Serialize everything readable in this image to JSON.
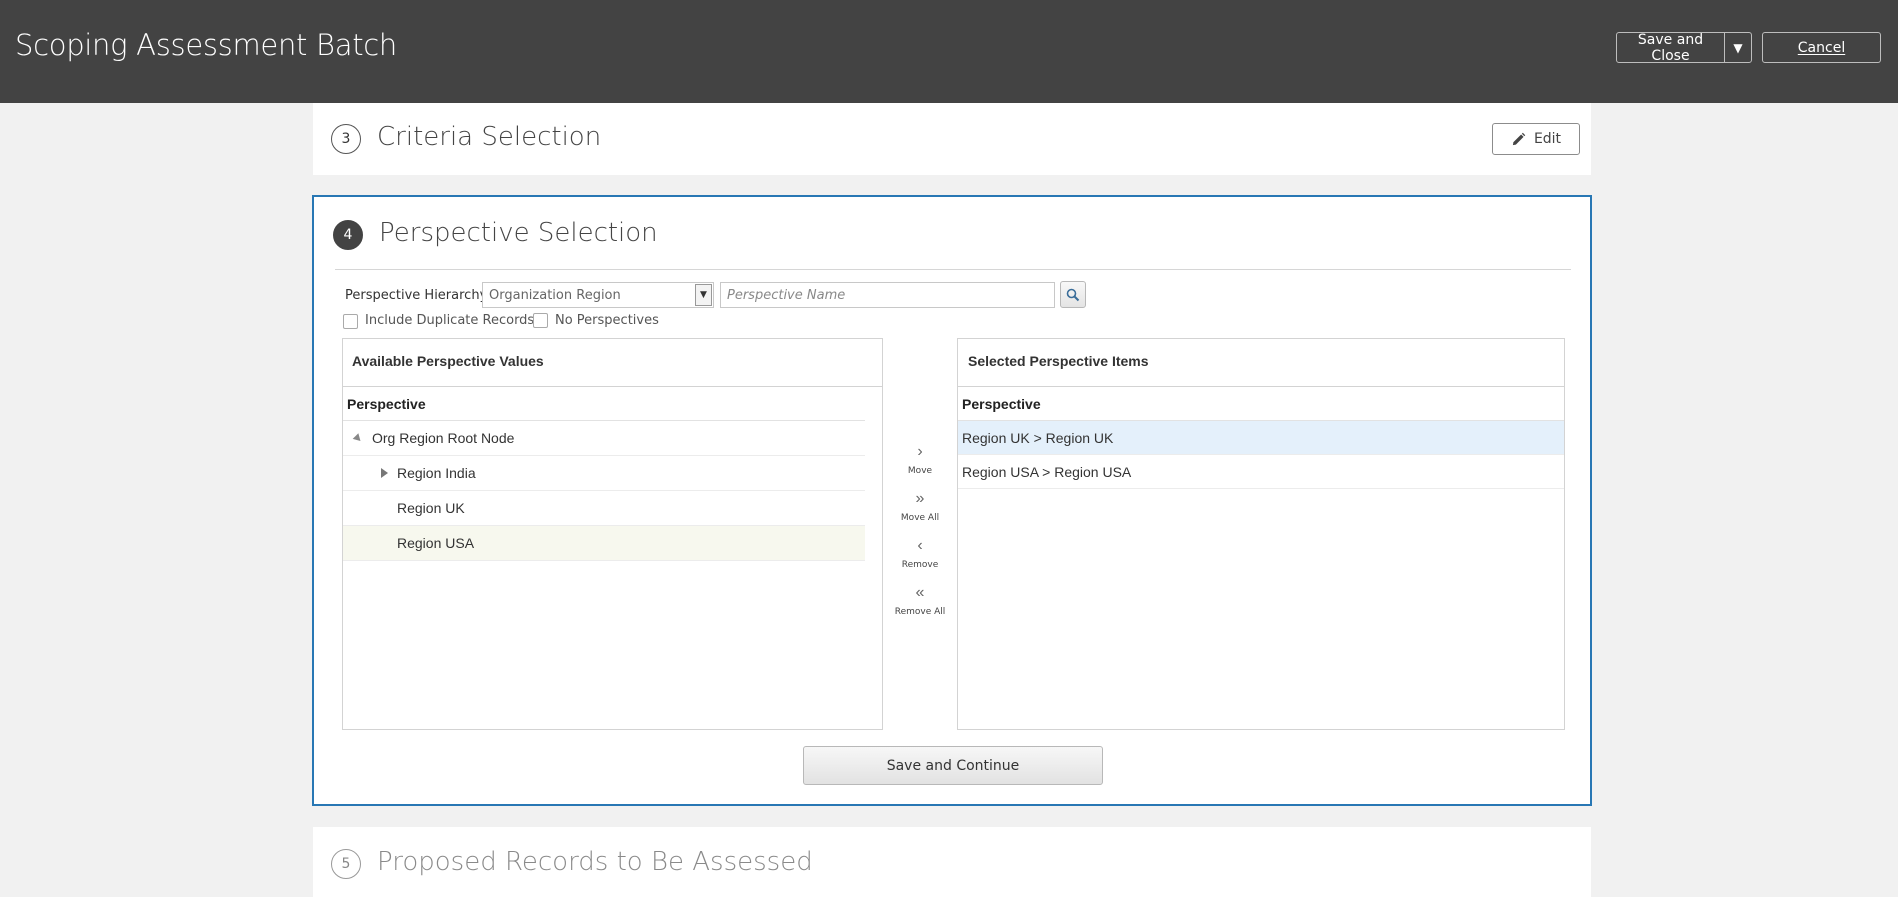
{
  "header": {
    "title": "Scoping Assessment Batch",
    "save_close_label": "Save and Close",
    "cancel_label": "Cancel"
  },
  "steps": {
    "criteria": {
      "number": "3",
      "title": "Criteria Selection",
      "edit_label": "Edit"
    },
    "perspective": {
      "number": "4",
      "title": "Perspective Selection"
    },
    "proposed": {
      "number": "5",
      "title": "Proposed Records to Be Assessed"
    }
  },
  "filters": {
    "hierarchy_label": "Perspective Hierarchy",
    "hierarchy_value": "Organization Region",
    "name_placeholder": "Perspective Name",
    "include_duplicates_label": "Include Duplicate Records",
    "no_perspectives_label": "No Perspectives"
  },
  "available": {
    "title": "Available Perspective Values",
    "column": "Perspective",
    "rows": [
      {
        "label": "Org Region Root Node"
      },
      {
        "label": "Region India"
      },
      {
        "label": "Region UK"
      },
      {
        "label": "Region USA"
      }
    ]
  },
  "shuttle": {
    "move": "Move",
    "move_all": "Move All",
    "remove": "Remove",
    "remove_all": "Remove All"
  },
  "selected": {
    "title": "Selected Perspective Items",
    "column": "Perspective",
    "rows": [
      {
        "label": "Region UK > Region UK"
      },
      {
        "label": "Region USA > Region USA"
      }
    ]
  },
  "actions": {
    "save_continue": "Save and Continue"
  }
}
